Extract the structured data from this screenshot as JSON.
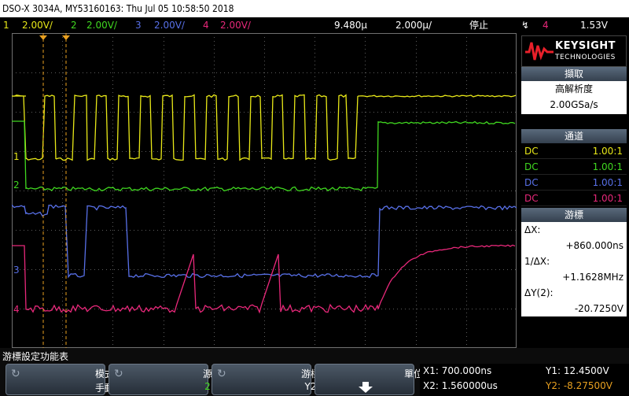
{
  "titlebar": {
    "text": "DSO-X 3034A, MY53160163: Thu Jul 05 10:58:50 2018"
  },
  "channels": [
    {
      "num": "1",
      "scale": "2.00V/",
      "color": "#e8e818"
    },
    {
      "num": "2",
      "scale": "2.00V/",
      "color": "#40d820"
    },
    {
      "num": "3",
      "scale": "2.00V/",
      "color": "#5870e8"
    },
    {
      "num": "4",
      "scale": "2.00V/",
      "color": "#e8287a"
    }
  ],
  "timebase": {
    "delay": "9.480µ",
    "scale": "2.000µ/",
    "run_state": "停止",
    "trig_edge": "↯",
    "trig_channel": "4",
    "trig_level": "1.53V"
  },
  "logo": {
    "brand": "KEYSIGHT",
    "sub": "TECHNOLOGIES"
  },
  "acquisition": {
    "header": "擷取",
    "label": "高解析度",
    "rate": "2.00GSa/s"
  },
  "channel_panel": {
    "header": "通道",
    "rows": [
      {
        "coupling": "DC",
        "probe": "1.00:1",
        "color": "#e8e818"
      },
      {
        "coupling": "DC",
        "probe": "1.00:1",
        "color": "#40d820"
      },
      {
        "coupling": "DC",
        "probe": "1.00:1",
        "color": "#5870e8"
      },
      {
        "coupling": "DC",
        "probe": "1.00:1",
        "color": "#e8287a"
      }
    ]
  },
  "cursor_panel": {
    "header": "游標",
    "dx_label": "ΔX:",
    "dx_value": "+860.000ns",
    "inv_label": "1/ΔX:",
    "inv_value": "+1.1628MHz",
    "dy_label": "ΔY(2):",
    "dy_value": "-20.7250V"
  },
  "menu": {
    "title": "游標設定功能表",
    "keys": [
      {
        "l1": "模式",
        "l2": "手動"
      },
      {
        "l1": "源",
        "l2": "2"
      },
      {
        "l1": "游標",
        "l2": "Y2"
      },
      {
        "l1": "單位",
        "l2": ""
      }
    ]
  },
  "readouts": {
    "x1": "X1: 700.000ns",
    "x2": "X2: 1.560000us",
    "y1": "Y1: 12.4500V",
    "y2": "Y2: -8.27500V"
  },
  "colors": {
    "cursor": "#e8a020",
    "grid": "#6a6a6a",
    "panel_head": "#4a5868"
  }
}
